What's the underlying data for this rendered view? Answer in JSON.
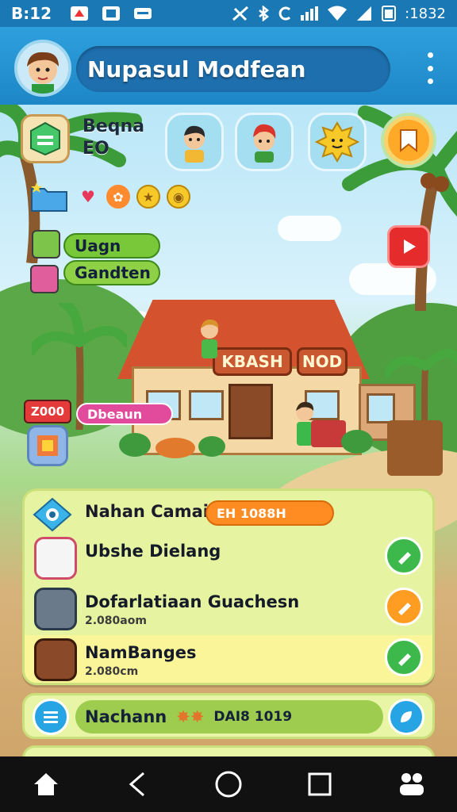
{
  "status_bar": {
    "time": "B:12",
    "right_text": ":1832",
    "icons": [
      "notification-icon",
      "image-icon",
      "message-icon",
      "no-sim-icon",
      "bluetooth-icon",
      "c-icon",
      "signal-icon",
      "wifi-icon",
      "battery-icon"
    ]
  },
  "header": {
    "title": "Nupasul Modfean",
    "menu_icon": "more-vertical-icon"
  },
  "top": {
    "resource_line1": "Beqna",
    "resource_line2": "EO",
    "friends": [
      "friend-waving",
      "friend-red-hair",
      "friend-sun"
    ],
    "orange_button_icon": "ribbon-icon"
  },
  "menu": {
    "item1": "Uagn",
    "item2": "Gandten"
  },
  "house_signs": {
    "left": "KBASH",
    "right": "NOD"
  },
  "left_card": {
    "badge": "Z000",
    "pill": "Dbeaun"
  },
  "panel": {
    "head_label": "Nahan Camai",
    "head_badge": "EH 1088H",
    "tasks": [
      {
        "title": "Ubshe Dielang",
        "sub": ""
      },
      {
        "title": "Dofarlatiaan Guachesn",
        "sub": "2.080aom"
      },
      {
        "title": "NamBanges",
        "sub": "2.080cm"
      }
    ]
  },
  "bottom_bar": {
    "label": "Nachann",
    "value": "DAI8 1019"
  },
  "colors": {
    "header": "#1d86c6",
    "panel": "#e6f3a0",
    "accent_orange": "#ff8c22",
    "accent_green": "#3db84a",
    "accent_blue": "#26a4e3"
  }
}
